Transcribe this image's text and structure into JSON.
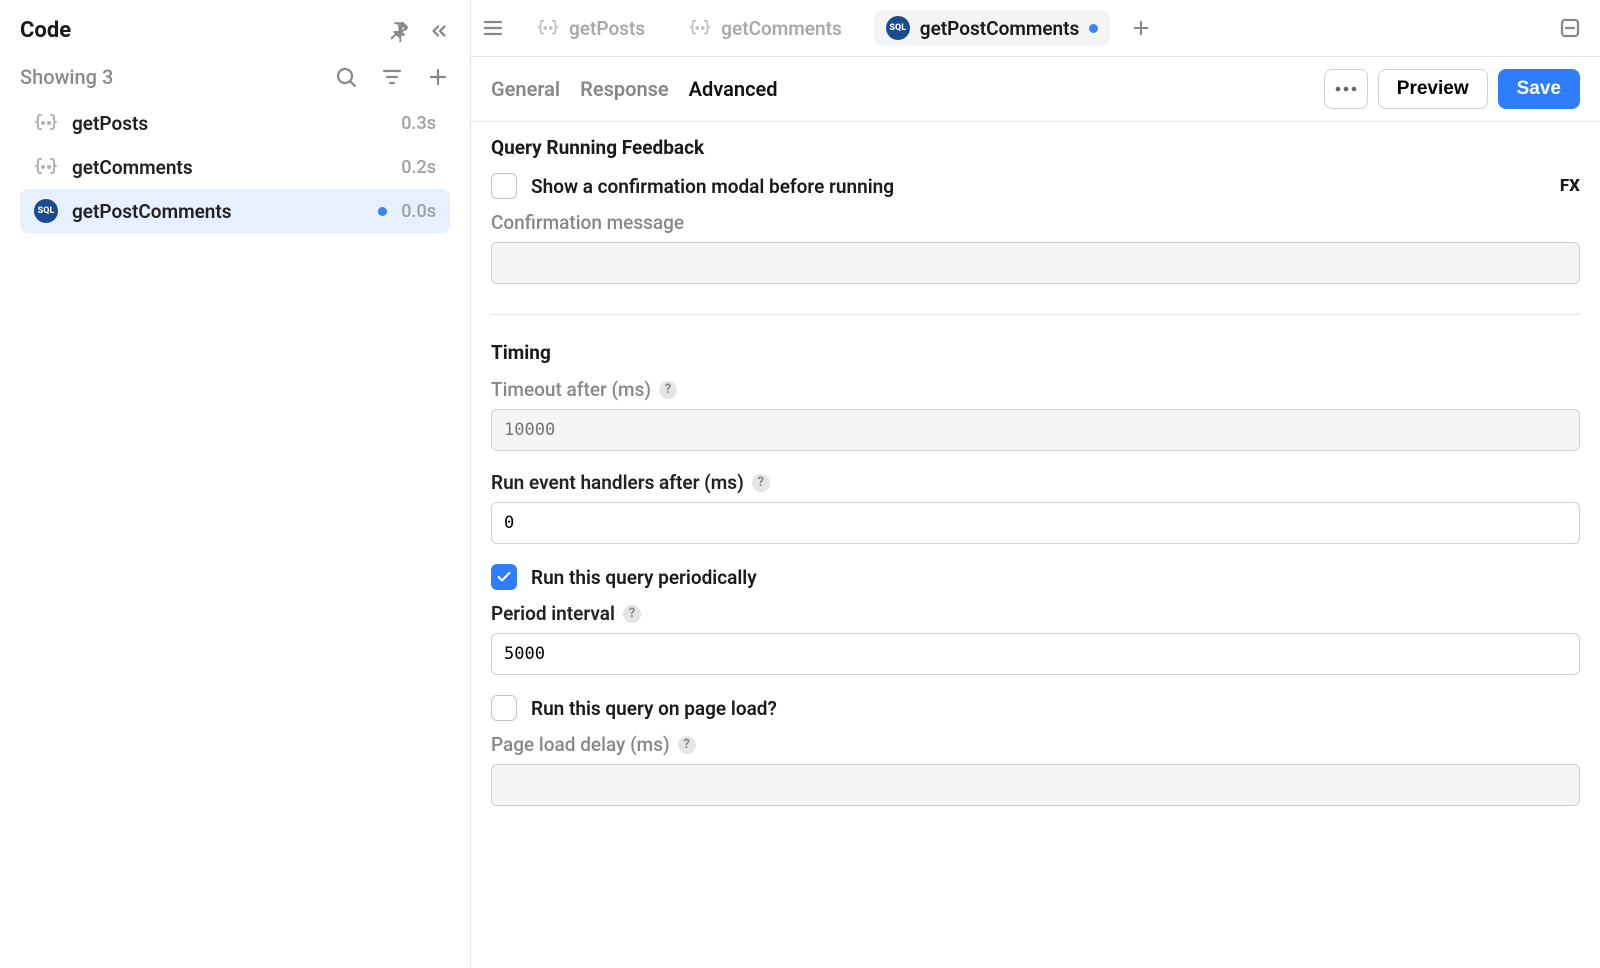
{
  "sidebar": {
    "title": "Code",
    "showing": "Showing 3",
    "items": [
      {
        "name": "getPosts",
        "time": "0.3s",
        "type": "js",
        "active": false,
        "unsaved": false
      },
      {
        "name": "getComments",
        "time": "0.2s",
        "type": "js",
        "active": false,
        "unsaved": false
      },
      {
        "name": "getPostComments",
        "time": "0.0s",
        "type": "sql",
        "active": true,
        "unsaved": true
      }
    ]
  },
  "tabs": [
    {
      "label": "getPosts",
      "type": "js",
      "active": false,
      "unsaved": false
    },
    {
      "label": "getComments",
      "type": "js",
      "active": false,
      "unsaved": false
    },
    {
      "label": "getPostComments",
      "type": "sql",
      "active": true,
      "unsaved": true
    }
  ],
  "subtabs": {
    "general": "General",
    "response": "Response",
    "advanced": "Advanced",
    "active": "advanced"
  },
  "actions": {
    "preview": "Preview",
    "save": "Save"
  },
  "sections": {
    "qrf": {
      "title": "Query Running Feedback",
      "show_confirm_label": "Show a confirmation modal before running",
      "show_confirm_checked": false,
      "fx": "FX",
      "confirm_msg_label": "Confirmation message",
      "confirm_msg_value": ""
    },
    "timing": {
      "title": "Timing",
      "timeout_label": "Timeout after (ms)",
      "timeout_placeholder": "10000",
      "handlers_label": "Run event handlers after (ms)",
      "handlers_value": "0",
      "periodic_label": "Run this query periodically",
      "periodic_checked": true,
      "interval_label": "Period interval",
      "interval_value": "5000",
      "pageload_label": "Run this query on page load?",
      "pageload_checked": false,
      "pageload_delay_label": "Page load delay (ms)",
      "pageload_delay_value": ""
    }
  },
  "sqlBadge": "SQL"
}
